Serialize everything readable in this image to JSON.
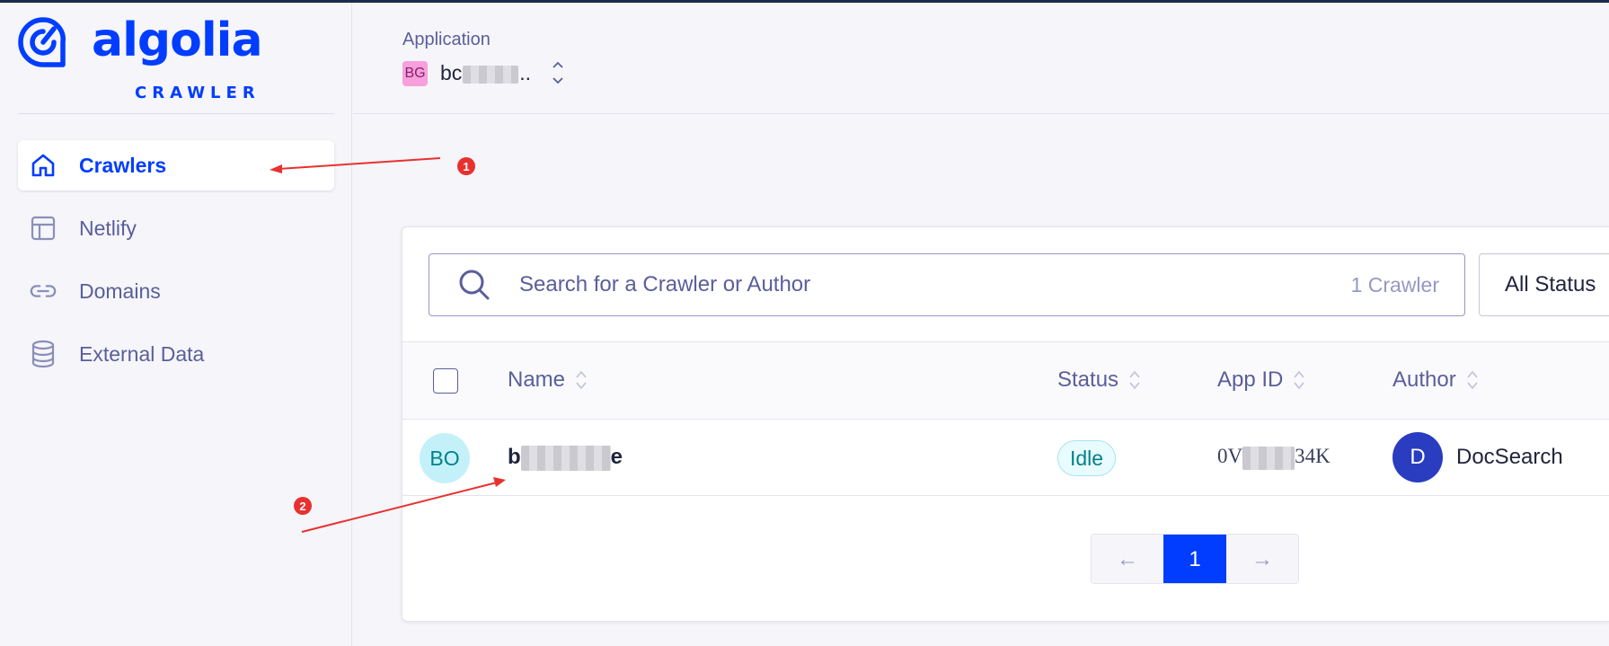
{
  "brand": {
    "name": "algolia",
    "product": "CRAWLER",
    "color": "#003dff"
  },
  "sidebar": {
    "items": [
      {
        "label": "Crawlers",
        "icon": "home-icon",
        "active": true
      },
      {
        "label": "Netlify",
        "icon": "layout-icon",
        "active": false
      },
      {
        "label": "Domains",
        "icon": "link-icon",
        "active": false
      },
      {
        "label": "External Data",
        "icon": "database-icon",
        "active": false
      }
    ]
  },
  "header": {
    "caption": "Application",
    "app_initials": "BG",
    "app_name_visible": "bc",
    "app_name_suffix": ".."
  },
  "search": {
    "placeholder": "Search for a Crawler or Author",
    "value": "",
    "count": "1 Crawler"
  },
  "status_filter": {
    "selected": "All Status"
  },
  "table": {
    "columns": [
      "Name",
      "Status",
      "App ID",
      "Author"
    ],
    "rows": [
      {
        "initials": "BO",
        "name_start": "b",
        "name_end": "e",
        "status": "Idle",
        "app_id_start": "0V",
        "app_id_end": "34K",
        "author_initial": "D",
        "author": "DocSearch"
      }
    ]
  },
  "pagination": {
    "prev": "←",
    "current": "1",
    "next": "→"
  },
  "annotations": [
    {
      "label": "1",
      "color": "#e8312f"
    },
    {
      "label": "2",
      "color": "#e8312f"
    }
  ]
}
